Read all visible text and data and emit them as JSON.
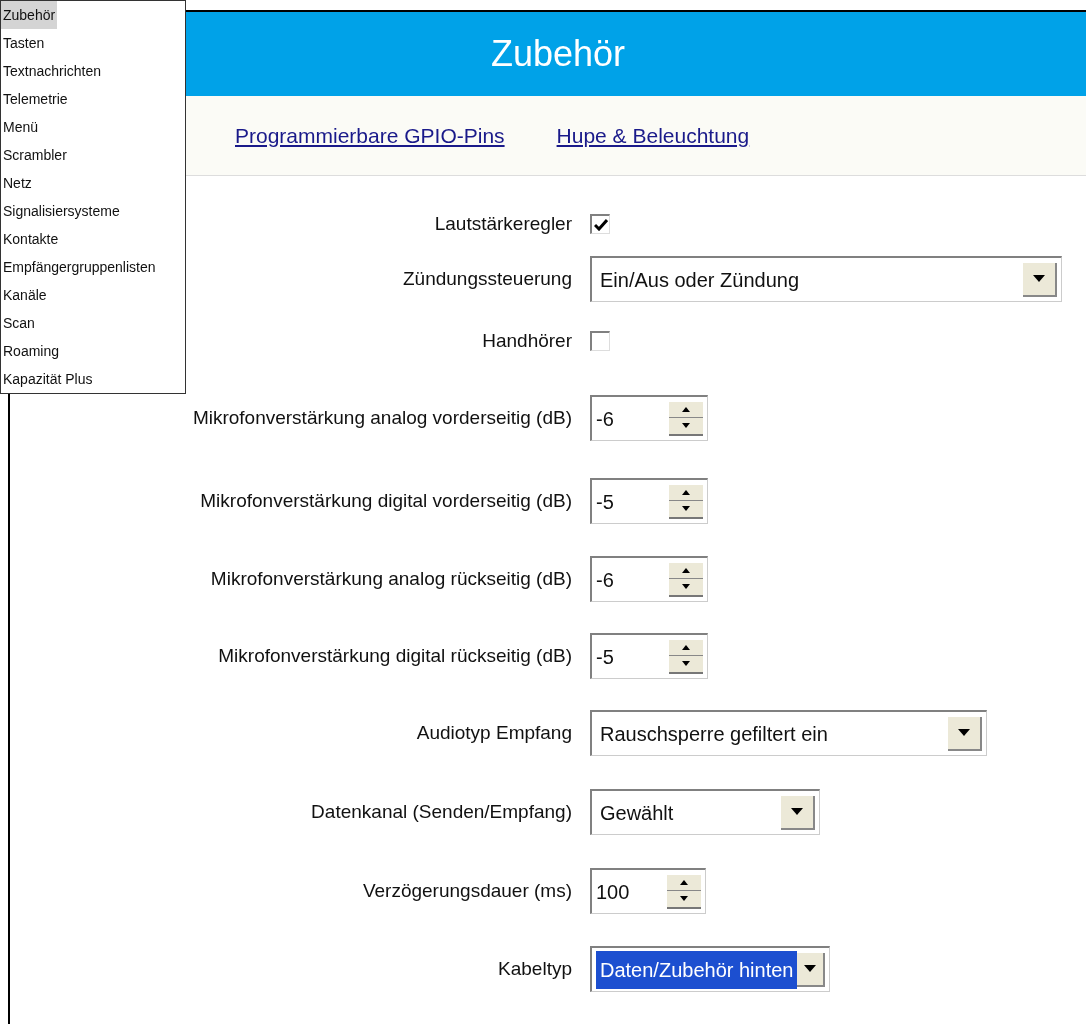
{
  "menu": {
    "items": [
      {
        "label": "Zubehör",
        "selected": true
      },
      {
        "label": "Tasten",
        "selected": false
      },
      {
        "label": "Textnachrichten",
        "selected": false
      },
      {
        "label": "Telemetrie",
        "selected": false
      },
      {
        "label": "Menü",
        "selected": false
      },
      {
        "label": "Scrambler",
        "selected": false
      },
      {
        "label": "Netz",
        "selected": false
      },
      {
        "label": "Signalisiersysteme",
        "selected": false
      },
      {
        "label": "Kontakte",
        "selected": false
      },
      {
        "label": "Empfängergruppenlisten",
        "selected": false
      },
      {
        "label": "Kanäle",
        "selected": false
      },
      {
        "label": "Scan",
        "selected": false
      },
      {
        "label": "Roaming",
        "selected": false
      },
      {
        "label": "Kapazität Plus",
        "selected": false
      }
    ]
  },
  "header": {
    "title": "Zubehör"
  },
  "links": [
    "Programmierbare GPIO-Pins",
    "Hupe & Beleuchtung"
  ],
  "form": {
    "rows": [
      {
        "kind": "checkbox",
        "label": "Lautstärkeregler",
        "checked": true
      },
      {
        "kind": "dropdown",
        "label": "Zündungssteuerung",
        "value": "Ein/Aus oder Zündung",
        "focused": false
      },
      {
        "kind": "checkbox",
        "label": "Handhörer",
        "checked": false
      },
      {
        "kind": "spinner",
        "label": "Mikrofonverstärkung analog vorderseitig (dB)",
        "value": "-6"
      },
      {
        "kind": "spinner",
        "label": "Mikrofonverstärkung digital vorderseitig (dB)",
        "value": "-5"
      },
      {
        "kind": "spinner",
        "label": "Mikrofonverstärkung analog rückseitig (dB)",
        "value": "-6"
      },
      {
        "kind": "spinner",
        "label": "Mikrofonverstärkung digital rückseitig (dB)",
        "value": "-5"
      },
      {
        "kind": "dropdown",
        "label": "Audiotyp Empfang",
        "value": "Rauschsperre gefiltert ein",
        "focused": false
      },
      {
        "kind": "dropdown",
        "label": "Datenkanal (Senden/Empfang)",
        "value": "Gewählt",
        "focused": false
      },
      {
        "kind": "spinner",
        "label": "Verzögerungsdauer (ms)",
        "value": "100"
      },
      {
        "kind": "dropdown",
        "label": "Kabeltyp",
        "value": "Daten/Zubehör hinten",
        "focused": true
      }
    ]
  }
}
